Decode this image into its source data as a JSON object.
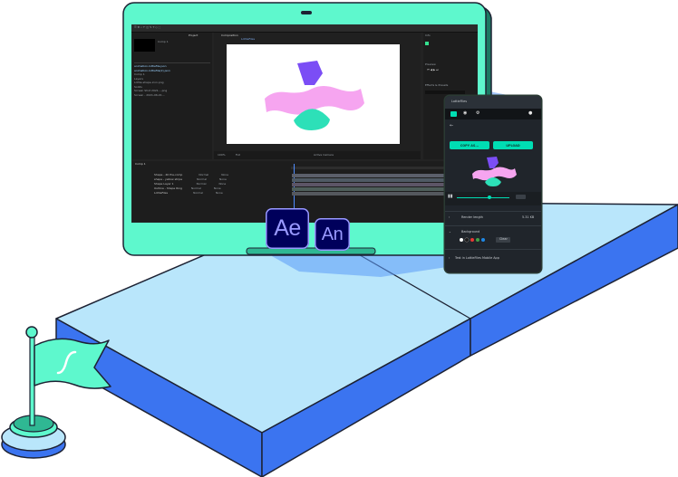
{
  "after_effects": {
    "composition_tab": "Composition",
    "comp_name": "LottieFiles",
    "project_tab": "Project",
    "timeline_tab": "Comp 1",
    "zoom": "100%",
    "view": "Full",
    "camera": "Active Camera",
    "project_items": [
      "animation-lottiefile.json",
      "animation-lottiefile(2).json",
      "Comp 1",
      "Layers",
      "Lottie-shape-icon.png",
      "Solids",
      "Screen Shot 2021-...png",
      "Screen - 2021-06-01..."
    ],
    "layers": [
      "Shape - 40 Pre-comp",
      "shape - yellow stripe",
      "Shape Layer 1",
      "Outline - Shape Ring",
      "LottieFiles"
    ],
    "mode_label": "Normal",
    "parent_label": "None",
    "effects_panel": "Effects & Presets",
    "preview_panel": "Preview",
    "info_panel": "Info"
  },
  "lottie_panel": {
    "tab": "LottieFiles",
    "copy_button": "COPY AS...",
    "upload_button": "UPLOAD",
    "render_label": "Render length",
    "render_value": "5.31 KB",
    "background_label": "Background",
    "background_action": "Clear",
    "mobile_label": "Test in LottieFiles Mobile App",
    "swatches": [
      "#ffffff",
      "#1c1c1c",
      "#e53935",
      "#43a047",
      "#1e88e5"
    ]
  },
  "badges": {
    "ae": "Ae",
    "an": "An"
  },
  "colors": {
    "mint": "#5ef8cd",
    "teal_dark": "#1b7a63",
    "blue_top": "#b9e6fb",
    "blue_side": "#3b82f6",
    "purple": "#7b4df5",
    "pink": "#f6a5f0",
    "teal_shape": "#2de0b8"
  },
  "icons": [
    "flag-icon",
    "lottie-logo-icon",
    "play-icon",
    "eye-icon",
    "user-icon",
    "back-arrow-icon",
    "chevron-right-icon"
  ]
}
